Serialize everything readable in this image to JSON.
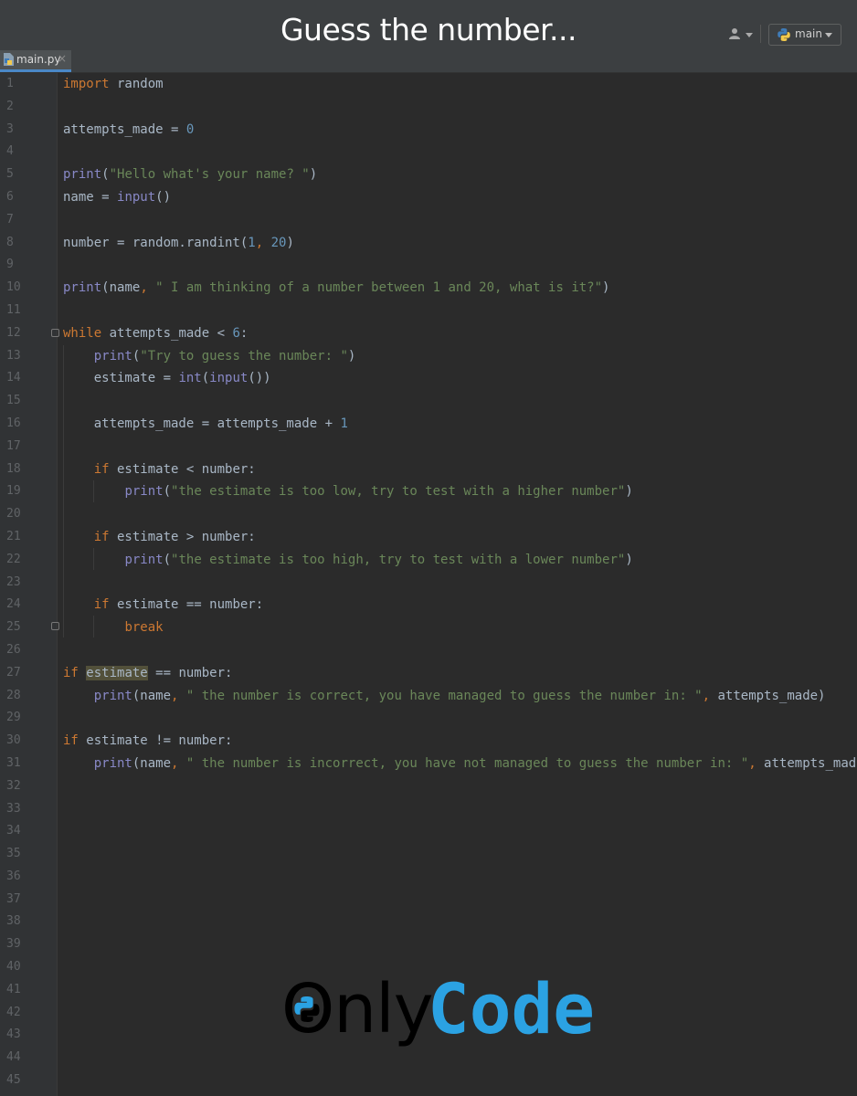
{
  "header": {
    "title": "Guess the number...",
    "branch_label": "main"
  },
  "tab": {
    "filename": "main.py",
    "close_glyph": "×"
  },
  "line_numbers": [
    "1",
    "2",
    "3",
    "4",
    "5",
    "6",
    "7",
    "8",
    "9",
    "10",
    "11",
    "12",
    "13",
    "14",
    "15",
    "16",
    "17",
    "18",
    "19",
    "20",
    "21",
    "22",
    "23",
    "24",
    "25",
    "26",
    "27",
    "28",
    "29",
    "30",
    "31",
    "32",
    "33",
    "34",
    "35",
    "36",
    "37",
    "38",
    "39",
    "40",
    "41",
    "42",
    "43",
    "44",
    "45"
  ],
  "code": {
    "l1": [
      "import",
      " random"
    ],
    "l3": [
      "attempts_made = ",
      "0"
    ],
    "l5": [
      "print",
      "(",
      "\"Hello what's your name? \"",
      ")"
    ],
    "l6": [
      "name = ",
      "input",
      "()"
    ],
    "l8": [
      "number = random.randint(",
      "1",
      ", ",
      "20",
      ")"
    ],
    "l10": [
      "print",
      "(name",
      ", ",
      "\" I am thinking of a number between 1 and 20, what is it?\"",
      ")"
    ],
    "l12": [
      "while",
      " attempts_made < ",
      "6",
      ":"
    ],
    "l13": [
      "    ",
      "print",
      "(",
      "\"Try to guess the number: \"",
      ")"
    ],
    "l14": [
      "    estimate = ",
      "int",
      "(",
      "input",
      "())"
    ],
    "l16": [
      "    attempts_made = attempts_made + ",
      "1"
    ],
    "l18": [
      "    ",
      "if",
      " estimate < number:"
    ],
    "l19": [
      "        ",
      "print",
      "(",
      "\"the estimate is too low, try to test with a higher number\"",
      ")"
    ],
    "l21": [
      "    ",
      "if",
      " estimate > number:"
    ],
    "l22": [
      "        ",
      "print",
      "(",
      "\"the estimate is too high, try to test with a lower number\"",
      ")"
    ],
    "l24": [
      "    ",
      "if",
      " estimate == number:"
    ],
    "l25": [
      "        ",
      "break"
    ],
    "l27": [
      "if",
      " ",
      "estimate",
      " == number:"
    ],
    "l28": [
      "    ",
      "print",
      "(name",
      ", ",
      "\" the number is correct, you have managed to guess the number in: \"",
      ", ",
      "attempts_made)"
    ],
    "l30": [
      "if",
      " estimate != number:"
    ],
    "l31": [
      "    ",
      "print",
      "(name",
      ", ",
      "\" the number is incorrect, you have not managed to guess the number in: \"",
      ", ",
      "attempts_made)"
    ]
  },
  "logo": {
    "part1": "Only",
    "part2": "Code",
    "part2_color": "#2ba2e3"
  },
  "colors": {
    "keyword": "#cc7832",
    "builtin": "#8888c6",
    "string": "#6a8759",
    "number": "#6897bb",
    "identifier": "#a9b7c6"
  },
  "icons": [
    "user-icon",
    "python-icon",
    "python-file-icon",
    "fold-icon",
    "python-logo-icon"
  ]
}
